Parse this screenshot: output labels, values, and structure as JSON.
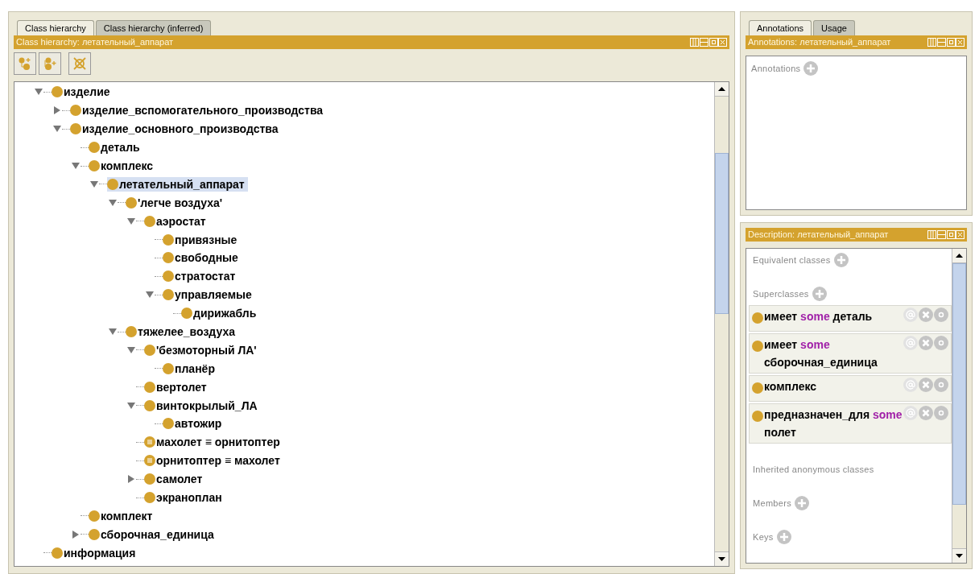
{
  "left_panel": {
    "tabs": [
      {
        "label": "Class hierarchy",
        "selected": true
      },
      {
        "label": "Class hierarchy (inferred)",
        "selected": false
      }
    ],
    "header": "Class hierarchy: летательный_аппарат",
    "tree": [
      {
        "label": "изделие",
        "kind": "class",
        "expanded": true,
        "selected": false,
        "children": [
          {
            "label": "изделие_вспомогательного_производства",
            "kind": "class",
            "expanded": false,
            "selected": false
          },
          {
            "label": "изделие_основного_производства",
            "kind": "class",
            "expanded": true,
            "selected": false,
            "children": [
              {
                "label": "деталь",
                "kind": "class",
                "selected": false
              },
              {
                "label": "комплекс",
                "kind": "class",
                "expanded": true,
                "selected": false,
                "children": [
                  {
                    "label": "летательный_аппарат",
                    "kind": "class",
                    "expanded": true,
                    "selected": true,
                    "children": [
                      {
                        "label": "'легче воздуха'",
                        "kind": "class",
                        "expanded": true,
                        "selected": false,
                        "children": [
                          {
                            "label": "аэростат",
                            "kind": "class",
                            "expanded": true,
                            "selected": false,
                            "children": [
                              {
                                "label": "привязные",
                                "kind": "class",
                                "selected": false
                              },
                              {
                                "label": "свободные",
                                "kind": "class",
                                "selected": false
                              },
                              {
                                "label": "стратостат",
                                "kind": "class",
                                "selected": false
                              },
                              {
                                "label": "управляемые",
                                "kind": "class",
                                "expanded": true,
                                "selected": false,
                                "children": [
                                  {
                                    "label": "дирижабль",
                                    "kind": "class",
                                    "selected": false
                                  }
                                ]
                              }
                            ]
                          }
                        ]
                      },
                      {
                        "label": "тяжелее_воздуха",
                        "kind": "class",
                        "expanded": true,
                        "selected": false,
                        "children": [
                          {
                            "label": "'безмоторный ЛА'",
                            "kind": "class",
                            "expanded": true,
                            "selected": false,
                            "children": [
                              {
                                "label": "планёр",
                                "kind": "class",
                                "selected": false
                              }
                            ]
                          },
                          {
                            "label": "вертолет",
                            "kind": "class",
                            "selected": false
                          },
                          {
                            "label": "винтокрылый_ЛА",
                            "kind": "class",
                            "expanded": true,
                            "selected": false,
                            "children": [
                              {
                                "label": "автожир",
                                "kind": "class",
                                "selected": false
                              }
                            ]
                          },
                          {
                            "label": "махолет ≡ орнитоптер",
                            "kind": "defined",
                            "selected": false
                          },
                          {
                            "label": "орнитоптер ≡ махолет",
                            "kind": "defined",
                            "selected": false
                          },
                          {
                            "label": "самолет",
                            "kind": "class",
                            "expanded": false,
                            "selected": false
                          },
                          {
                            "label": "экраноплан",
                            "kind": "class",
                            "selected": false
                          }
                        ]
                      }
                    ]
                  }
                ]
              },
              {
                "label": "комплект",
                "kind": "class",
                "selected": false
              },
              {
                "label": "сборочная_единица",
                "kind": "class",
                "expanded": false,
                "selected": false
              }
            ]
          }
        ]
      },
      {
        "label": "информация",
        "kind": "class",
        "selected": false
      }
    ]
  },
  "annotations_panel": {
    "tabs": [
      {
        "label": "Annotations",
        "selected": true
      },
      {
        "label": "Usage",
        "selected": false
      }
    ],
    "header": "Annotations: летательный_аппарат",
    "section": "Annotations"
  },
  "description_panel": {
    "header": "Description: летательный_аппарат",
    "sections": [
      {
        "title": "Equivalent classes",
        "addable": true
      },
      {
        "title": "Superclasses",
        "addable": true,
        "items": [
          {
            "parts": [
              {
                "text": "имеет",
                "keyword": false
              },
              {
                "text": "some",
                "keyword": true
              },
              {
                "text": "деталь",
                "keyword": false
              }
            ]
          },
          {
            "parts": [
              {
                "text": "имеет",
                "keyword": false
              },
              {
                "text": "some",
                "keyword": true
              },
              {
                "text": "сборочная_единица",
                "keyword": false
              }
            ]
          },
          {
            "parts": [
              {
                "text": "комплекс",
                "keyword": false
              }
            ]
          },
          {
            "parts": [
              {
                "text": "предназначен_для",
                "keyword": false
              },
              {
                "text": "some",
                "keyword": true
              },
              {
                "text": "полет",
                "keyword": false
              }
            ]
          }
        ]
      },
      {
        "title": "Inherited anonymous classes",
        "addable": false
      },
      {
        "title": "Members",
        "addable": true
      },
      {
        "title": "Keys",
        "addable": true
      }
    ]
  }
}
